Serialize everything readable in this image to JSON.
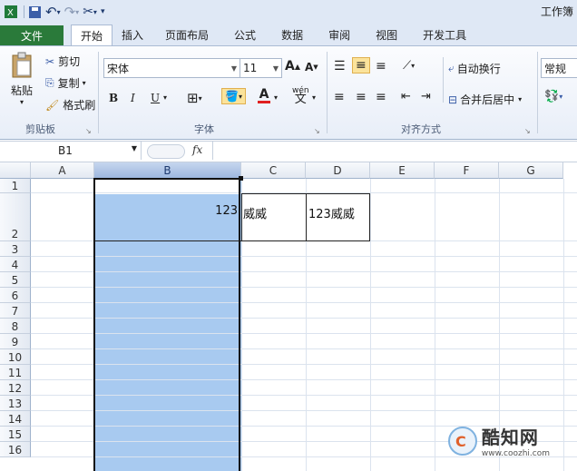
{
  "app": {
    "title": "工作簿"
  },
  "tabs": [
    {
      "label": "文件"
    },
    {
      "label": "开始"
    },
    {
      "label": "插入"
    },
    {
      "label": "页面布局"
    },
    {
      "label": "公式"
    },
    {
      "label": "数据"
    },
    {
      "label": "审阅"
    },
    {
      "label": "视图"
    },
    {
      "label": "开发工具"
    }
  ],
  "clipboard": {
    "paste": "粘贴",
    "cut": "剪切",
    "copy": "复制",
    "format_painter": "格式刷",
    "group": "剪贴板"
  },
  "font": {
    "name": "宋体",
    "size": "11",
    "bold": "B",
    "italic": "I",
    "underline": "U",
    "group": "字体",
    "wen": "wén"
  },
  "alignment": {
    "wrap": "自动换行",
    "merge": "合并后居中",
    "group": "对齐方式"
  },
  "number": {
    "format": "常规"
  },
  "formula_bar": {
    "cell_ref": "B1",
    "fx": "fx",
    "value": ""
  },
  "columns": [
    "A",
    "B",
    "C",
    "D",
    "E",
    "F",
    "G"
  ],
  "rows": [
    "1",
    "2",
    "3",
    "4",
    "5",
    "6",
    "7",
    "8",
    "9",
    "10",
    "11",
    "12",
    "13",
    "14",
    "15",
    "16"
  ],
  "cells": {
    "B2": "123",
    "C2": "威威",
    "D2": "123威威"
  },
  "watermark": {
    "name": "酷知网",
    "url": "www.coozhi.com"
  },
  "colors": {
    "file_tab": "#2a7a3a",
    "selection": "#a8caf0",
    "ribbon": "#dfe8f5"
  }
}
